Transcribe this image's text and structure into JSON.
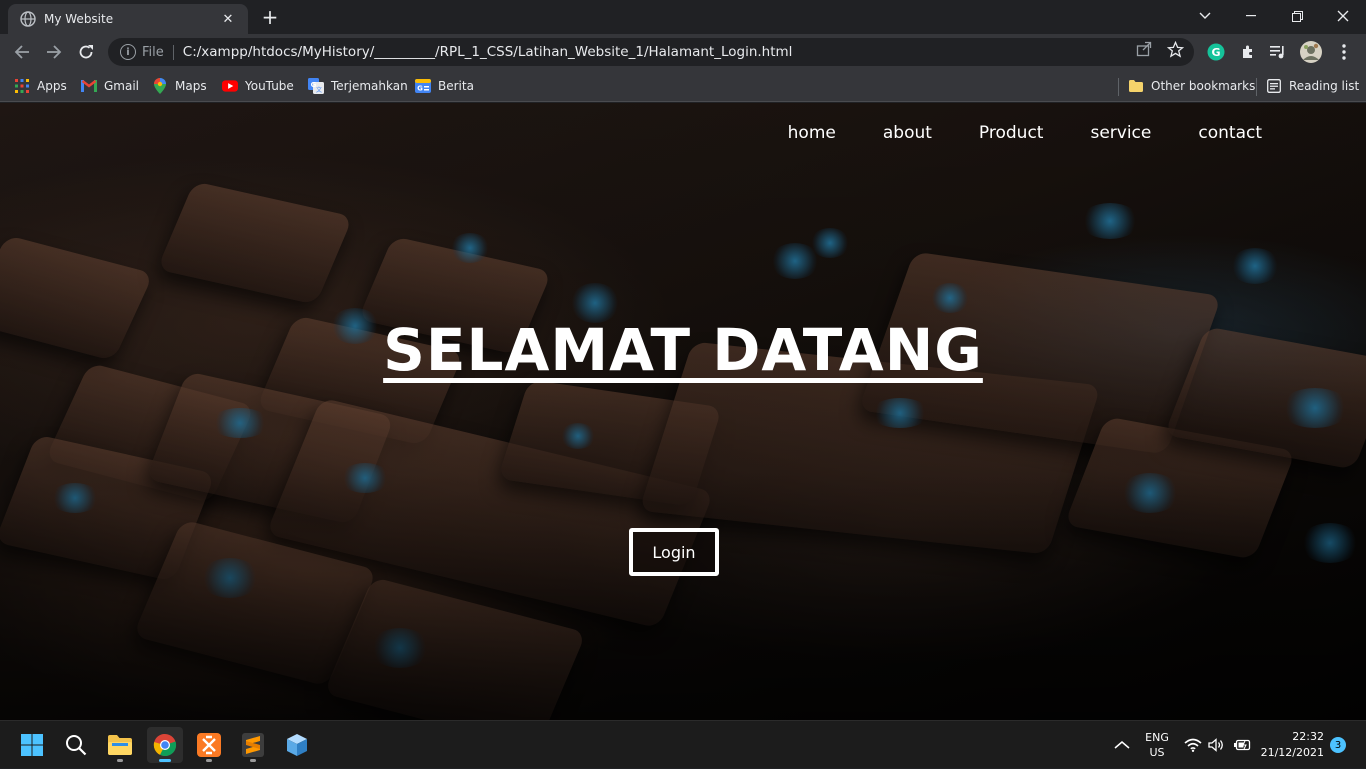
{
  "browser": {
    "tab_title": "My Website",
    "scheme_label": "File",
    "url": "C:/xampp/htdocs/MyHistory/_________/RPL_1_CSS/Latihan_Website_1/Halamant_Login.html",
    "bookmarks": [
      "Apps",
      "Gmail",
      "Maps",
      "YouTube",
      "Terjemahkan",
      "Berita"
    ],
    "other_bookmarks": "Other bookmarks",
    "reading_list": "Reading list"
  },
  "site": {
    "nav": [
      "home",
      "about",
      "Product",
      "service",
      "contact"
    ],
    "hero_title": "SELAMAT DATANG",
    "login_label": "Login"
  },
  "taskbar": {
    "lang_top": "ENG",
    "lang_bottom": "US",
    "time": "22:32",
    "date": "21/12/2021",
    "notification_count": "3"
  }
}
